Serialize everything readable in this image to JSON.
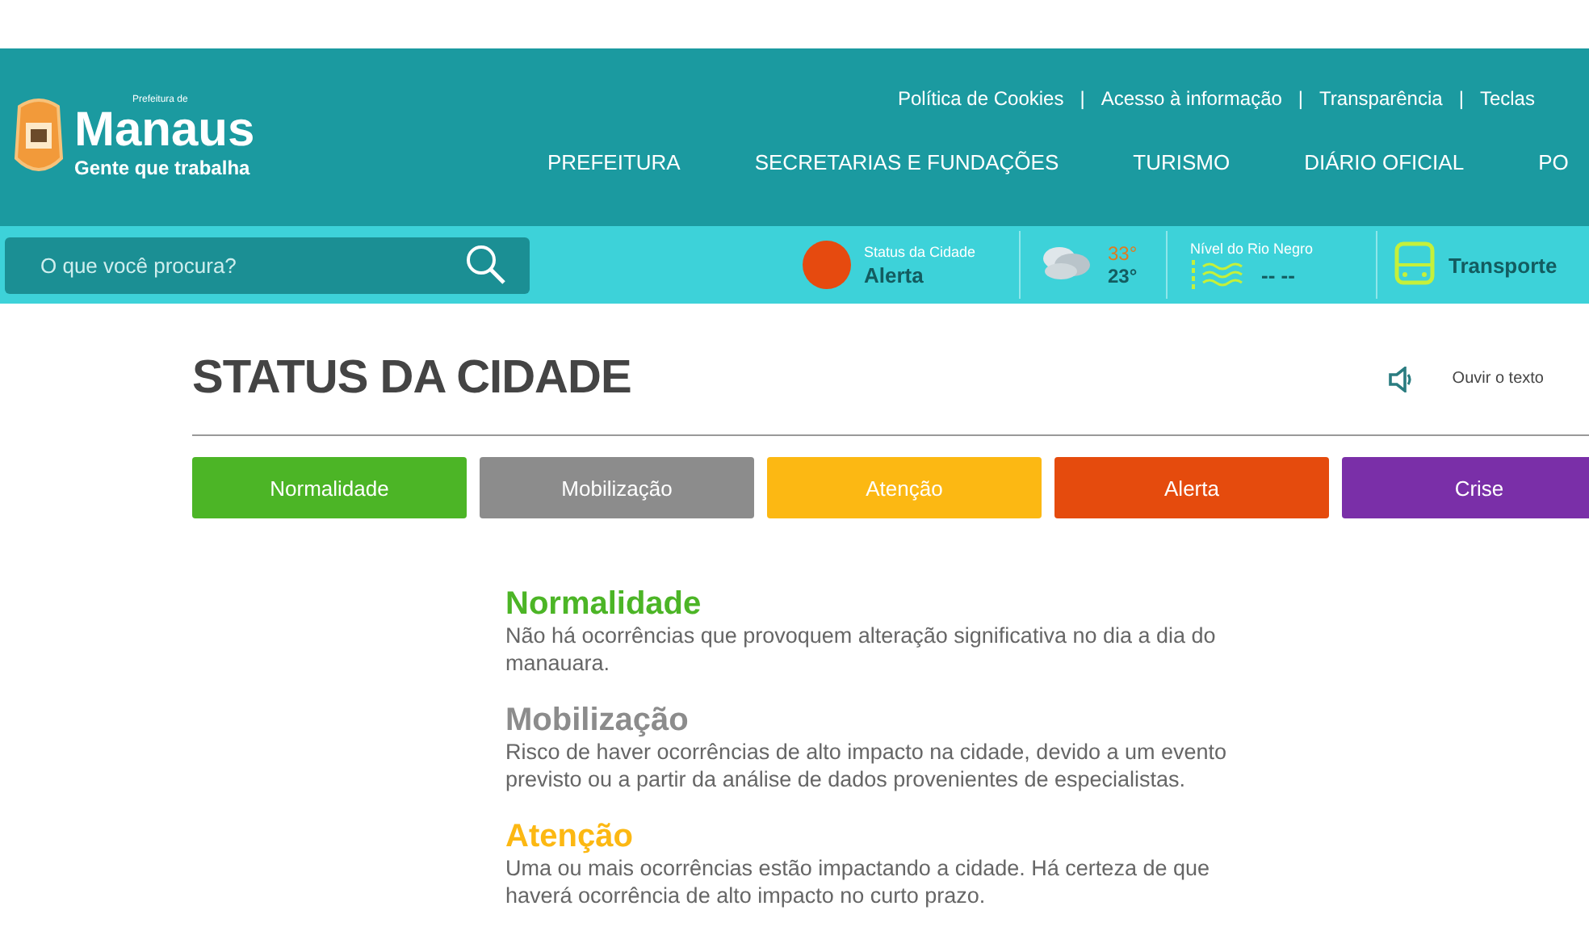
{
  "logo": {
    "prefix": "Prefeitura de",
    "name": "Manaus",
    "slogan": "Gente que trabalha"
  },
  "top_links": [
    "Política de Cookies",
    "Acesso à informação",
    "Transparência",
    "Teclas"
  ],
  "link_separator": "|",
  "nav": [
    "PREFEITURA",
    "SECRETARIAS E FUNDAÇÕES",
    "TURISMO",
    "DIÁRIO OFICIAL",
    "PO"
  ],
  "search": {
    "placeholder": "O que você procura?"
  },
  "city_status": {
    "label": "Status da Cidade",
    "value": "Alerta",
    "color": "#e64a0f"
  },
  "weather": {
    "high": "33°",
    "low": "23°"
  },
  "river": {
    "label": "Nível do Rio Negro",
    "value": "-- --"
  },
  "transport": {
    "label": "Transporte"
  },
  "page_title": "STATUS DA CIDADE",
  "listen": "Ouvir o texto",
  "levels": [
    {
      "label": "Normalidade",
      "color": "#4cb526"
    },
    {
      "label": "Mobilização",
      "color": "#8c8c8c"
    },
    {
      "label": "Atenção",
      "color": "#fcb813"
    },
    {
      "label": "Alerta",
      "color": "#e54b0d"
    },
    {
      "label": "Crise",
      "color": "#7a2fa8"
    }
  ],
  "descriptions": [
    {
      "title": "Normalidade",
      "color": "#4cb526",
      "text": "Não há ocorrências que provoquem alteração significativa no dia a dia do manauara."
    },
    {
      "title": "Mobilização",
      "color": "#8c8c8c",
      "text": "Risco de haver ocorrências de alto impacto na cidade, devido a um evento previsto ou a partir da análise de dados provenientes de especialistas."
    },
    {
      "title": "Atenção",
      "color": "#fcb813",
      "text": "Uma ou mais ocorrências estão impactando a cidade. Há certeza de que haverá ocorrência de alto impacto no curto prazo."
    }
  ]
}
